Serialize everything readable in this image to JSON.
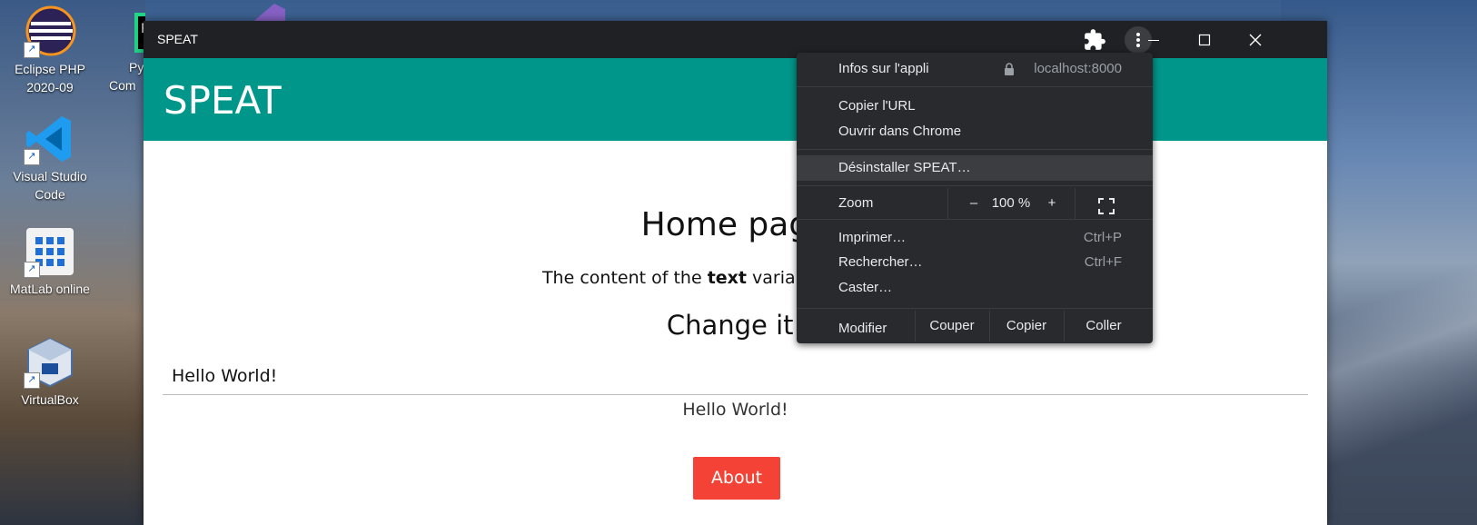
{
  "desktop": {
    "icons": [
      {
        "label_line1": "Eclipse PHP",
        "label_line2": "2020-09"
      },
      {
        "label_line1": "Visual Studio",
        "label_line2": "Code"
      },
      {
        "label_line1": "MatLab online",
        "label_line2": ""
      },
      {
        "label_line1": "VirtualBox",
        "label_line2": ""
      },
      {
        "label_line1": "Py",
        "label_line2": "Com"
      }
    ]
  },
  "window": {
    "title": "SPEAT",
    "appbar_title": "SPEAT",
    "home_heading": "Home page",
    "content_prefix": "The content of the ",
    "content_bold": "text",
    "content_suffix": " variable is currently:",
    "change_heading": "Change it!",
    "input_value": "Hello World!",
    "echo_text": "Hello World!",
    "about_label": "About"
  },
  "menu": {
    "app_info": "Infos sur l'appli",
    "origin": "localhost:8000",
    "copy_url": "Copier l'URL",
    "open_in_chrome": "Ouvrir dans Chrome",
    "uninstall": "Désinstaller SPEAT…",
    "zoom_label": "Zoom",
    "zoom_minus": "–",
    "zoom_value": "100 %",
    "zoom_plus": "+",
    "print": "Imprimer…",
    "print_shortcut": "Ctrl+P",
    "find": "Rechercher…",
    "find_shortcut": "Ctrl+F",
    "cast": "Caster…",
    "edit": "Modifier",
    "cut": "Couper",
    "copy": "Copier",
    "paste": "Coller"
  },
  "colors": {
    "appbar": "#00968a",
    "about_button": "#f44336",
    "titlebar": "#202124",
    "menu_bg": "#292a2d"
  }
}
